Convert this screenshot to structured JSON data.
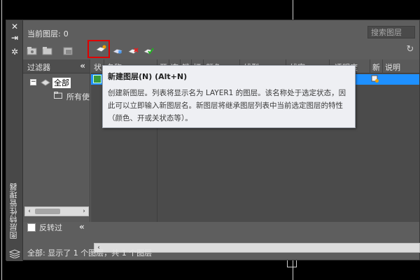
{
  "palette": {
    "vertical_title": "图层特性管理器",
    "current_layer_label": "当前图层:",
    "current_layer_value": "0",
    "search_placeholder": "搜索图层"
  },
  "filter_panel": {
    "header": "过滤器",
    "collapse_glyph": "«",
    "tree": [
      {
        "label": "全部",
        "selected": true
      },
      {
        "label": "所有使"
      }
    ],
    "invert_label": "反转过"
  },
  "grid": {
    "columns": [
      "状",
      "名称",
      "开",
      "冻",
      "锁",
      "打",
      "颜色",
      "线型",
      "线宽",
      "透明度",
      "新",
      "说明"
    ],
    "row_color": "#1e90ff"
  },
  "status_text": "全部: 显示了 1 个图层，共 1 个图层",
  "tooltip": {
    "title": "新建图层(N)  (Alt+N)",
    "body": "创建新图层。列表将显示名为 LAYER1 的图层。该名称处于选定状态，因此可以立即输入新图层名。新图层将继承图层列表中当前选定图层的特性（颜色、开或关状态等）。"
  },
  "colors": {
    "highlight": "#e00000",
    "selection": "#1e90ff"
  }
}
